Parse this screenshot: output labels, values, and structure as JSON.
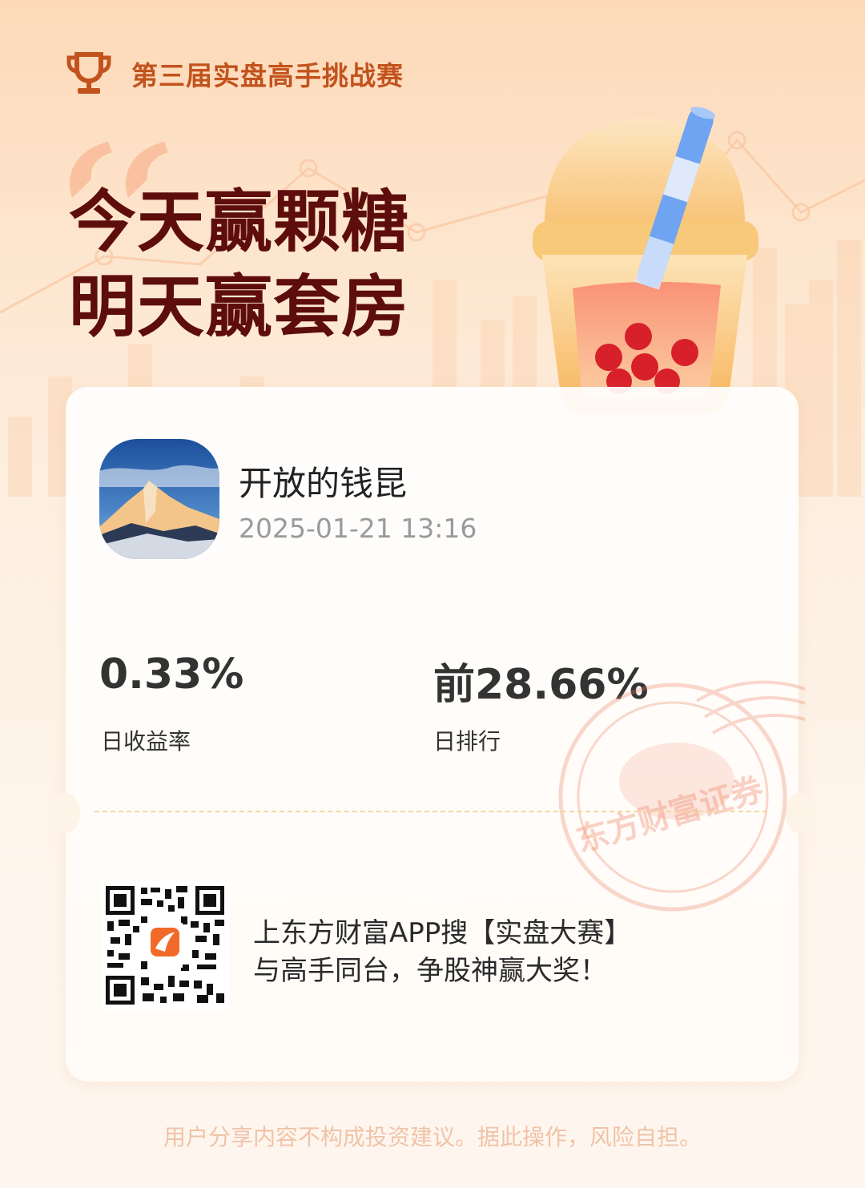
{
  "header": {
    "title": "第三届实盘高手挑战赛"
  },
  "headline": {
    "line1": "今天赢颗糖",
    "line2": "明天赢套房"
  },
  "profile": {
    "username": "开放的钱昆",
    "datetime": "2025-01-21 13:16"
  },
  "stats": [
    {
      "value": "0.33%",
      "label": "日收益率"
    },
    {
      "value": "前28.66%",
      "label": "日排行"
    }
  ],
  "stamp": {
    "text": "东方财富证券"
  },
  "promo": {
    "line1": "上东方财富APP搜【实盘大赛】",
    "line2": "与高手同台，争股神赢大奖！"
  },
  "disclaimer": "用户分享内容不构成投资建议。据此操作，风险自担。",
  "icons": [
    "trophy-icon",
    "quote-icon",
    "milk-tea-illustration",
    "qr-code",
    "avatar-mountain"
  ],
  "colors": {
    "accent": "#c2531c",
    "headline": "#5e0d0d",
    "background": "#fde6cf"
  }
}
